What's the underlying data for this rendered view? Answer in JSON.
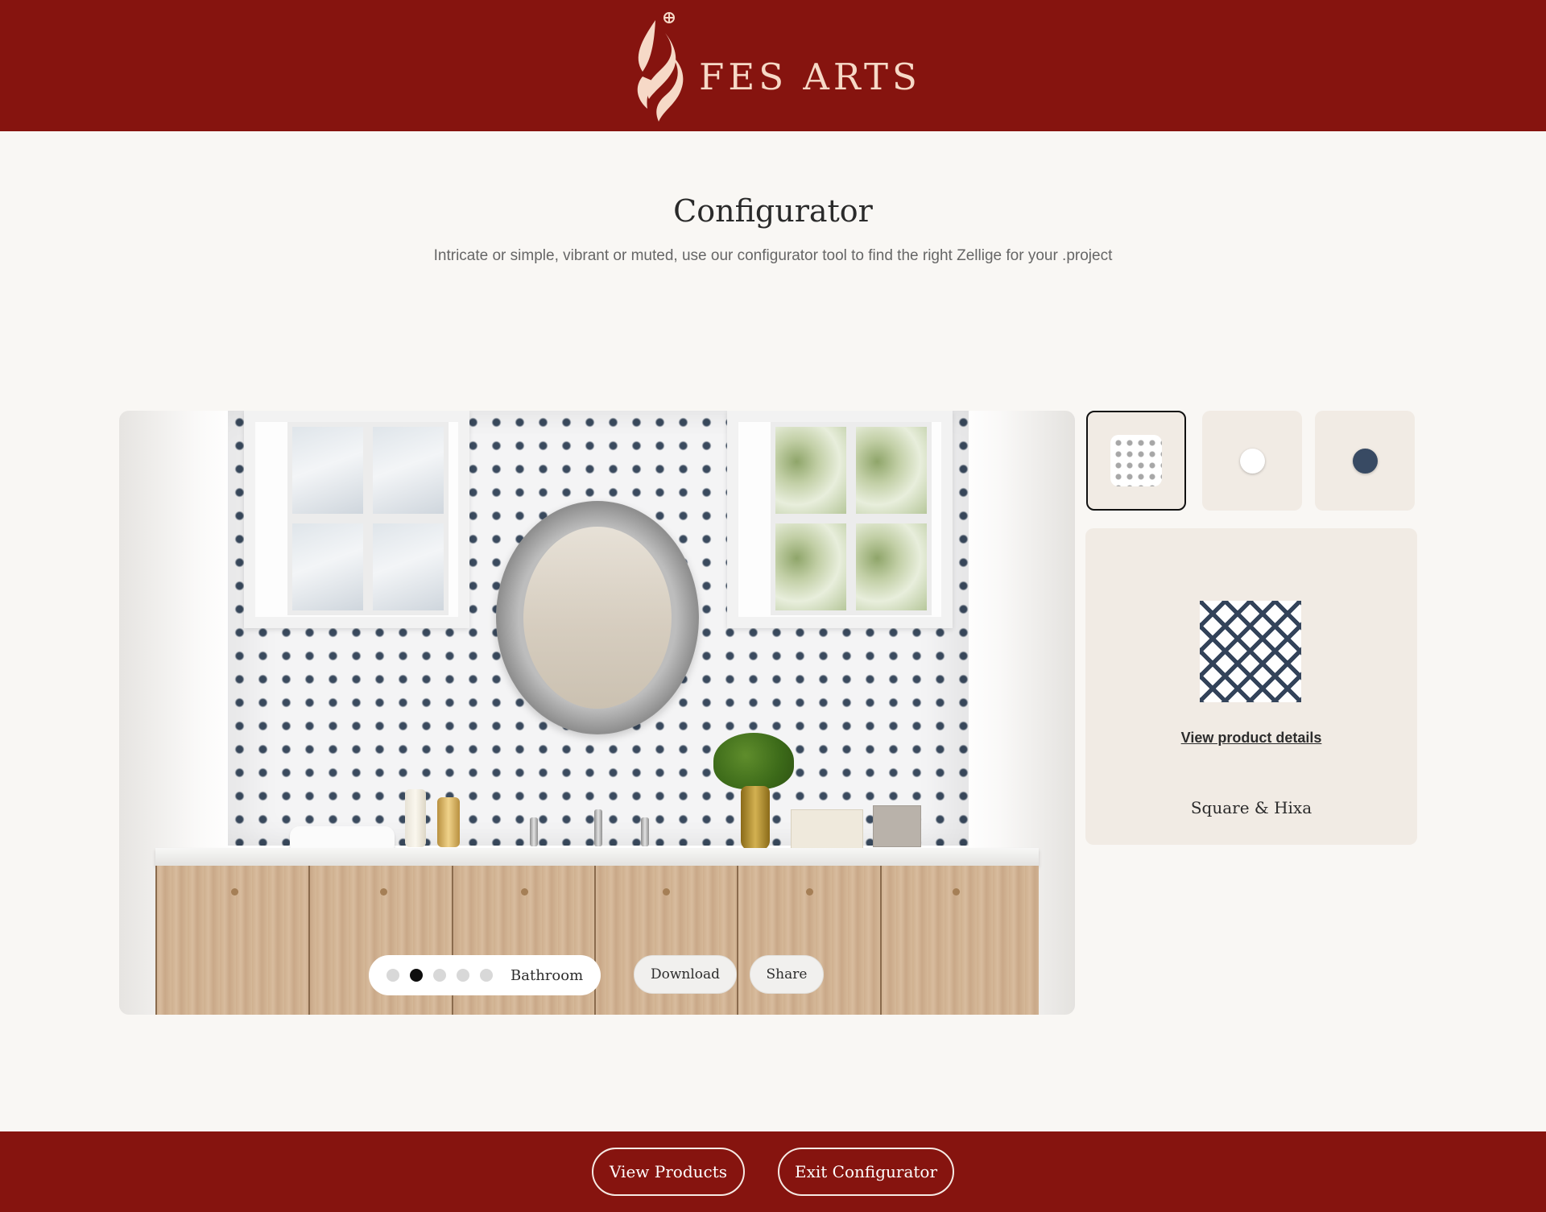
{
  "header": {
    "brand_name": "FES ARTS",
    "logo_icon": "calligraphy-flame-logo"
  },
  "intro": {
    "title": "Configurator",
    "description": "Intricate or simple, vibrant or muted, use our configurator tool to find the right Zellige for your .project"
  },
  "preview": {
    "scene_dots": [
      {
        "active": false
      },
      {
        "active": true
      },
      {
        "active": false
      },
      {
        "active": false
      },
      {
        "active": false
      }
    ],
    "scene_label": "Bathroom",
    "download_label": "Download",
    "share_label": "Share"
  },
  "swatches": [
    {
      "type": "pattern",
      "selected": true
    },
    {
      "type": "color",
      "color": "#ffffff",
      "selected": false
    },
    {
      "type": "color",
      "color": "#384a63",
      "selected": false
    }
  ],
  "product": {
    "link_label": "View product details",
    "name": "Square & Hixa"
  },
  "footer": {
    "view_products_label": "View Products",
    "exit_label": "Exit Configurator"
  },
  "colors": {
    "brand_red": "#86140f",
    "logo_cream": "#f6d9c7",
    "panel_beige": "#f1ebe4",
    "page_bg": "#f9f7f4",
    "tile_navy": "#384a63"
  }
}
